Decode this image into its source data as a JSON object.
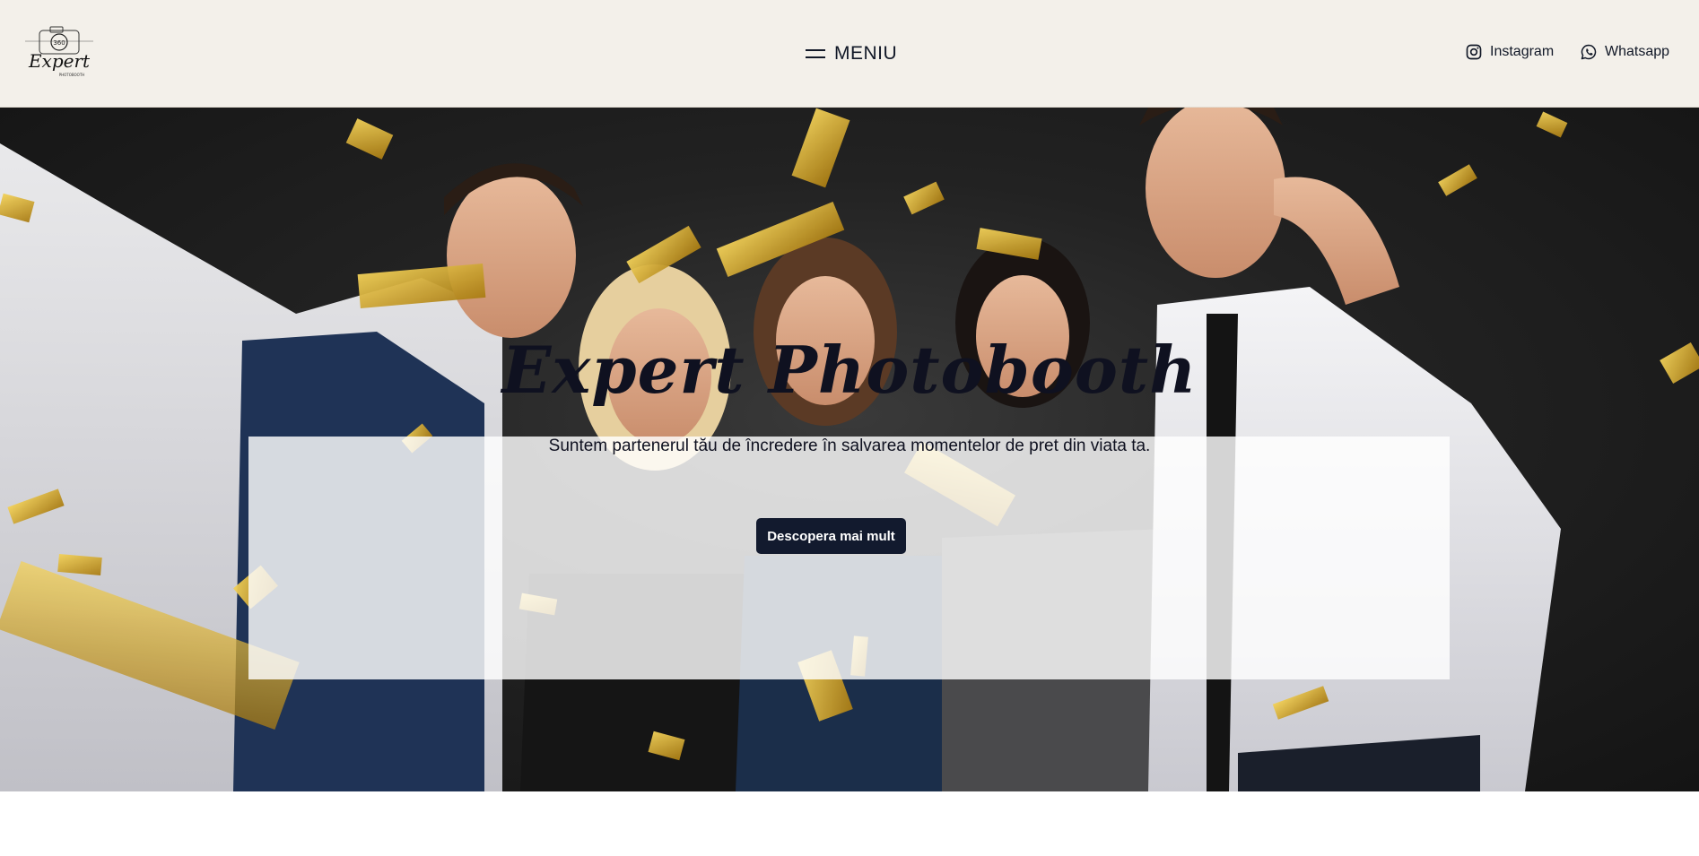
{
  "header": {
    "logo_text": "Expert",
    "logo_subtext": "PHOTOBOOTH",
    "logo_badge": "360",
    "menu_label": "MENIU",
    "menu_icon": "hamburger-icon",
    "social": [
      {
        "label": "Instagram",
        "icon": "instagram-icon"
      },
      {
        "label": "Whatsapp",
        "icon": "whatsapp-icon"
      }
    ]
  },
  "hero": {
    "title": "Expert Photobooth",
    "subtitle": "Suntem partenerul tău de încredere în salvarea momentelor de pret din viata ta.",
    "cta_label": "Descopera mai mult",
    "image": "group of friends celebrating with gold confetti"
  },
  "colors": {
    "header_bg": "#f3f0ea",
    "button_bg": "#121a2e",
    "text": "#0f1120",
    "confetti": "#d4a82a"
  }
}
